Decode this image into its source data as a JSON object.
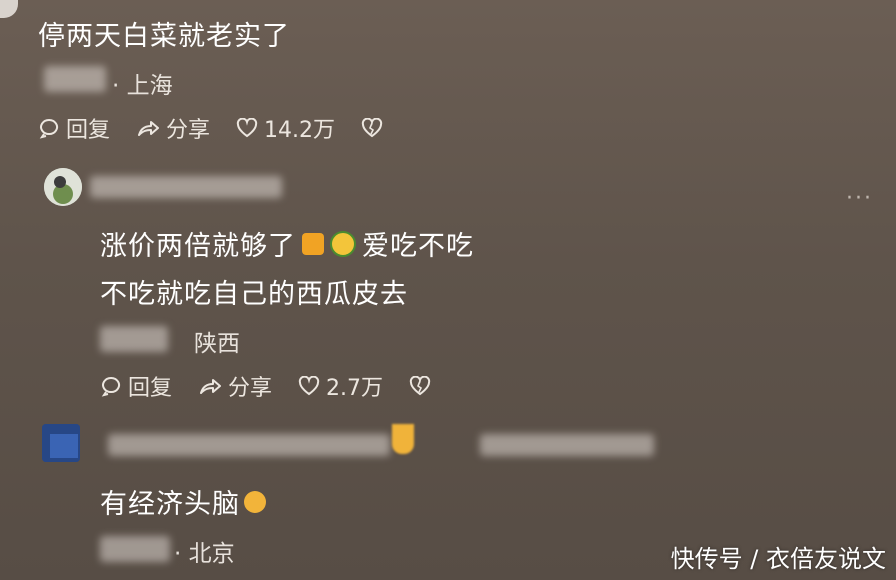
{
  "comments": [
    {
      "text": "停两天白菜就老实了",
      "location": "· 上海",
      "reply_label": "回复",
      "share_label": "分享",
      "likes": "14.2万"
    },
    {
      "text_line1_a": "涨价两倍就够了",
      "text_line1_b": "爱吃不吃",
      "text_line2": "不吃就吃自己的西瓜皮去",
      "location": "陕西",
      "reply_label": "回复",
      "share_label": "分享",
      "likes": "2.7万",
      "more": "···"
    },
    {
      "text": "有经济头脑",
      "location": "· 北京"
    }
  ],
  "watermark": "快传号 / 衣倍友说文",
  "icons": {
    "reply": "comment-bubble-icon",
    "share": "share-arrow-icon",
    "like": "heart-icon",
    "dislike": "broken-heart-icon"
  }
}
